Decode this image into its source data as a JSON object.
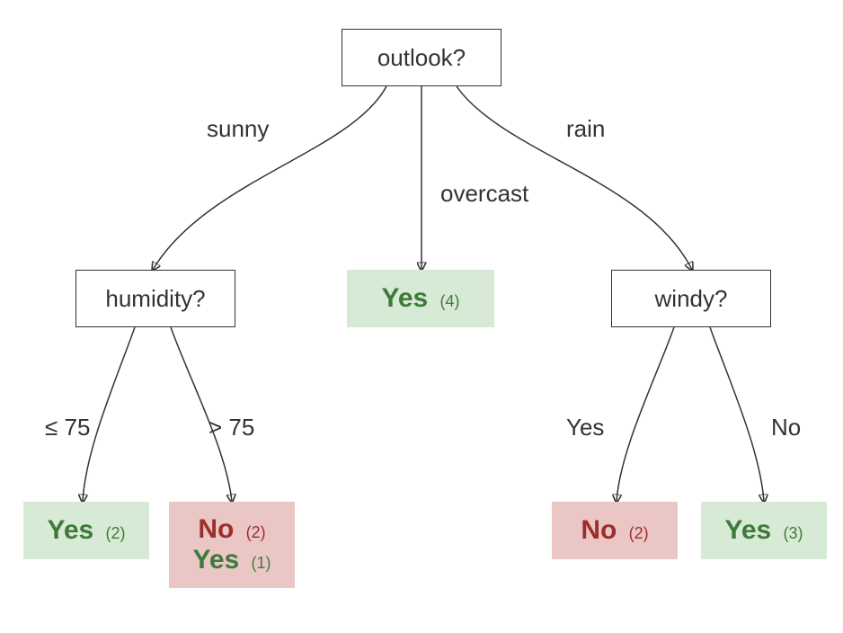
{
  "tree": {
    "root": {
      "label": "outlook?",
      "branches": {
        "left": {
          "edge": "sunny"
        },
        "middle": {
          "edge": "overcast"
        },
        "right": {
          "edge": "rain"
        }
      }
    },
    "humidity": {
      "label": "humidity?",
      "branches": {
        "left": {
          "edge": "≤ 75"
        },
        "right": {
          "edge": "> 75"
        }
      }
    },
    "windy": {
      "label": "windy?",
      "branches": {
        "left": {
          "edge": "Yes"
        },
        "right": {
          "edge": "No"
        }
      }
    },
    "leaves": {
      "overcast_yes": {
        "class": "Yes",
        "count": "(4)"
      },
      "humidity_le75_yes": {
        "class": "Yes",
        "count": "(2)"
      },
      "humidity_gt75_no": {
        "major_class": "No",
        "major_count": "(2)",
        "minor_class": "Yes",
        "minor_count": "(1)"
      },
      "windy_yes_no": {
        "class": "No",
        "count": "(2)"
      },
      "windy_no_yes": {
        "class": "Yes",
        "count": "(3)"
      }
    }
  },
  "colors": {
    "yes": "#3f7a3b",
    "no": "#9d2e2b",
    "leaf_green_bg": "#d7ead5",
    "leaf_red_bg": "#eac7c5"
  }
}
